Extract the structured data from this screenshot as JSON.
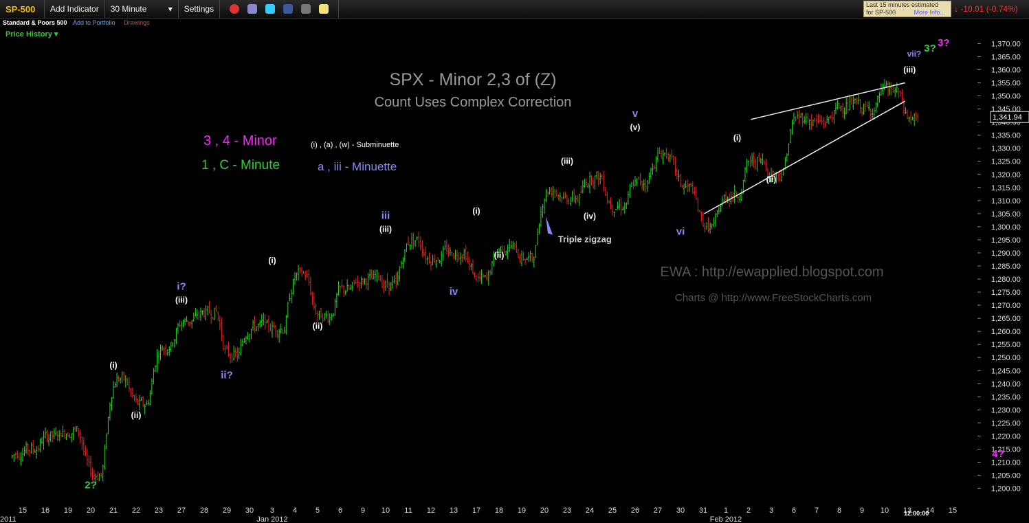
{
  "toolbar": {
    "symbol": "SP-500",
    "add_indicator": "Add Indicator",
    "interval": "30 Minute",
    "settings": "Settings"
  },
  "subbar": {
    "name": "Standard & Poors 500",
    "add_portfolio": "Add to Portfolio",
    "drawings": "Drawings",
    "price_history": "Price History"
  },
  "quote": {
    "line1": "Last 15 minutes estimated",
    "line2": "for SP-500",
    "more": "More Info...",
    "change": "-10.01 (-0.74%)",
    "last": "1,341.94",
    "arrow": "↓"
  },
  "colors": {
    "up": "#22dd22",
    "down": "#ee2222",
    "minor": "#ff22ff",
    "minute": "#33cc33",
    "minuette": "#8888ff",
    "sub": "#ffffff"
  },
  "chart_data": {
    "type": "candlestick",
    "title": "SPX - Minor 2,3 of (Z)",
    "subtitle": "Count Uses Complex Correction",
    "ylim": [
      1197,
      1373
    ],
    "x_categories": [
      "15",
      "16",
      "19",
      "20",
      "21",
      "22",
      "23",
      "27",
      "28",
      "29",
      "30",
      "3",
      "4",
      "5",
      "6",
      "9",
      "10",
      "11",
      "12",
      "13",
      "17",
      "18",
      "19",
      "20",
      "23",
      "24",
      "25",
      "26",
      "27",
      "30",
      "31",
      "1",
      "2",
      "3",
      "6",
      "7",
      "8",
      "9",
      "10",
      "13",
      "14",
      "15"
    ],
    "x_month_labels": [
      "2011",
      "Jan 2012",
      "Feb 2012"
    ],
    "x_time_label": "12:00:00",
    "y_ticks": [
      1200,
      1205,
      1210,
      1215,
      1220,
      1225,
      1230,
      1235,
      1240,
      1245,
      1250,
      1255,
      1260,
      1265,
      1270,
      1275,
      1280,
      1285,
      1290,
      1295,
      1300,
      1305,
      1310,
      1315,
      1320,
      1325,
      1330,
      1335,
      1340,
      1345,
      1350,
      1355,
      1360,
      1365,
      1370
    ],
    "daily_close": [
      1215,
      1220,
      1222,
      1205,
      1242,
      1232,
      1254,
      1264,
      1267,
      1251,
      1262,
      1261,
      1282,
      1266,
      1276,
      1280,
      1278,
      1295,
      1288,
      1290,
      1280,
      1292,
      1288,
      1314,
      1311,
      1319,
      1308,
      1317,
      1328,
      1315,
      1300,
      1312,
      1325,
      1320,
      1342,
      1340,
      1346,
      1345,
      1352,
      1341
    ],
    "legend": [
      {
        "text": "3 , 4 - Minor",
        "color": "#ff22ff"
      },
      {
        "text": "1 , C - Minute",
        "color": "#33cc33"
      },
      {
        "text": "(i) , (a) , (w) - Subminuette",
        "color": "#ffffff"
      },
      {
        "text": "a , iii - Minuette",
        "color": "#8888ff"
      }
    ],
    "annotations": [
      {
        "text": "2?",
        "color": "#33cc33",
        "day": 3,
        "price": 1200
      },
      {
        "text": "(i)",
        "color": "#ffffff",
        "day": 4,
        "price": 1246
      },
      {
        "text": "(ii)",
        "color": "#ffffff",
        "day": 5,
        "price": 1227
      },
      {
        "text": "i?",
        "color": "#8888ff",
        "day": 7,
        "price": 1276
      },
      {
        "text": "(iii)",
        "color": "#ffffff",
        "day": 7,
        "price": 1271
      },
      {
        "text": "ii?",
        "color": "#8888ff",
        "day": 9,
        "price": 1242
      },
      {
        "text": "(i)",
        "color": "#ffffff",
        "day": 11,
        "price": 1286
      },
      {
        "text": "(ii)",
        "color": "#ffffff",
        "day": 13,
        "price": 1261
      },
      {
        "text": "iii",
        "color": "#8888ff",
        "day": 16,
        "price": 1303
      },
      {
        "text": "(iii)",
        "color": "#ffffff",
        "day": 16,
        "price": 1298
      },
      {
        "text": "iv",
        "color": "#8888ff",
        "day": 19,
        "price": 1274
      },
      {
        "text": "(i)",
        "color": "#ffffff",
        "day": 20,
        "price": 1305
      },
      {
        "text": "(ii)",
        "color": "#ffffff",
        "day": 21,
        "price": 1288
      },
      {
        "text": "Triple zigzag",
        "color": "#cccccc",
        "day": 23.6,
        "price": 1294
      },
      {
        "text": "(iii)",
        "color": "#ffffff",
        "day": 24,
        "price": 1324
      },
      {
        "text": "(iv)",
        "color": "#ffffff",
        "day": 25,
        "price": 1303
      },
      {
        "text": "v",
        "color": "#8888ff",
        "day": 27,
        "price": 1342
      },
      {
        "text": "(v)",
        "color": "#ffffff",
        "day": 27,
        "price": 1337
      },
      {
        "text": "vi",
        "color": "#8888ff",
        "day": 29,
        "price": 1297
      },
      {
        "text": "(i)",
        "color": "#ffffff",
        "day": 31.5,
        "price": 1333
      },
      {
        "text": "(ii)",
        "color": "#ffffff",
        "day": 33,
        "price": 1317
      },
      {
        "text": "(iii)",
        "color": "#ffffff",
        "day": 39.1,
        "price": 1359
      },
      {
        "text": "vii?",
        "color": "#8888ff",
        "day": 39.3,
        "price": 1365
      },
      {
        "text": "3?",
        "color": "#33cc33",
        "day": 40,
        "price": 1367
      },
      {
        "text": "3?",
        "color": "#ff22ff",
        "day": 40.6,
        "price": 1369
      },
      {
        "text": "4?",
        "color": "#ff22ff",
        "day": 43,
        "price": 1212
      }
    ],
    "watermark1": "EWA : http://ewapplied.blogspot.com",
    "watermark2": "Charts @ http://www.FreeStockCharts.com"
  }
}
